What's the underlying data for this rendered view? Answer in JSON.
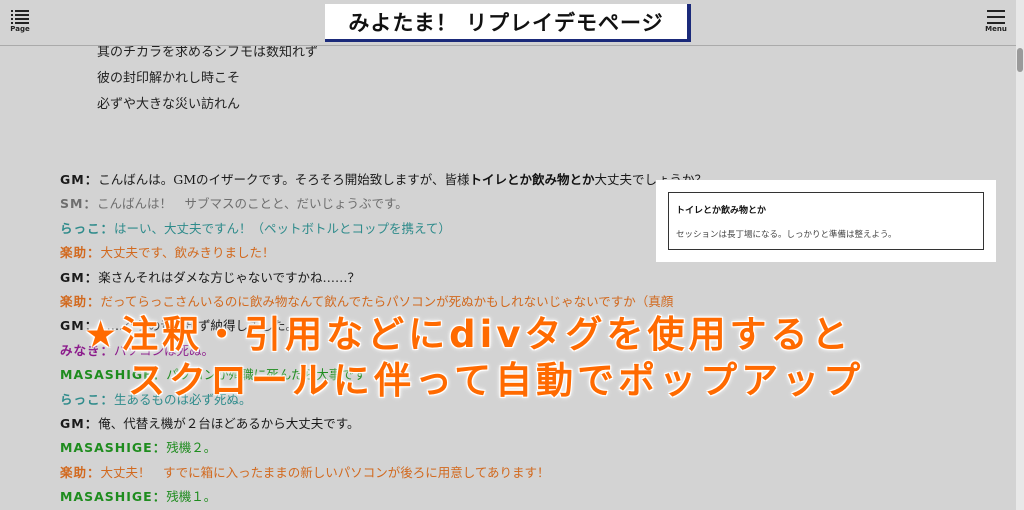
{
  "header": {
    "title": "みよたま！ リプレイデモページ",
    "page_label": "Page",
    "menu_label": "Menu"
  },
  "poem": [
    "其のチカラを求めるシフモは数知れず",
    "彼の封印解かれし時こそ",
    "必ずや大きな災い訪れん"
  ],
  "chat": [
    {
      "speaker": "GM：",
      "color": "#1a1a1a",
      "pre": "こんばんは。GMのイザークです。そろそろ開始致しますが、皆様",
      "highlight": "トイレとか飲み物とか",
      "post": "大丈夫でしょうか？"
    },
    {
      "speaker": "SM：",
      "color": "#6e6e6e",
      "text": "こんばんは！　サブマスのことと、だいじょうぶです。"
    },
    {
      "speaker": "らっこ：",
      "color": "#2e8b8b",
      "text": "はーい、大丈夫ですん！（ペットボトルとコップを携えて）"
    },
    {
      "speaker": "楽助：",
      "color": "#d2691e",
      "text": "大丈夫です、飲みきりました！"
    },
    {
      "speaker": "GM：",
      "color": "#1a1a1a",
      "text": "楽さんそれはダメな方じゃないですかね……？"
    },
    {
      "speaker": "楽助：",
      "color": "#d2691e",
      "text": "だってらっこさんいるのに飲み物なんて飲んでたらパソコンが死ぬかもしれないじゃないですか（真顔"
    },
    {
      "speaker": "GM：",
      "color": "#1a1a1a",
      "text": "……ぐうの音も出ず納得しました。"
    },
    {
      "speaker": "みなき：",
      "color": "#8b1a8b",
      "text": "パソコンは死ぬ。"
    },
    {
      "speaker": "MASASHIGE：",
      "color": "#1e8c1e",
      "text": "パソコンが殉職に死んだら大事です"
    },
    {
      "speaker": "らっこ：",
      "color": "#2e8b8b",
      "text": "生あるものは必ず死ぬ。"
    },
    {
      "speaker": "GM：",
      "color": "#1a1a1a",
      "text": "俺、代替え機が２台ほどあるから大丈夫です。"
    },
    {
      "speaker": "MASASHIGE：",
      "color": "#1e8c1e",
      "text": "残機２。"
    },
    {
      "speaker": "楽助：",
      "color": "#d2691e",
      "text": "大丈夫！　すでに箱に入ったままの新しいパソコンが後ろに用意してあります！"
    },
    {
      "speaker": "MASASHIGE：",
      "color": "#1e8c1e",
      "text": "残機１。"
    }
  ],
  "note": {
    "title": "トイレとか飲み物とか",
    "body": "セッションは長丁場になる。しっかりと準備は整えよう。"
  },
  "overlay": {
    "line1": "★注釈・引用などにdivタグを使用すると",
    "line2": "スクロールに伴って自動でポップアップ",
    "color": "#ff6a00"
  }
}
